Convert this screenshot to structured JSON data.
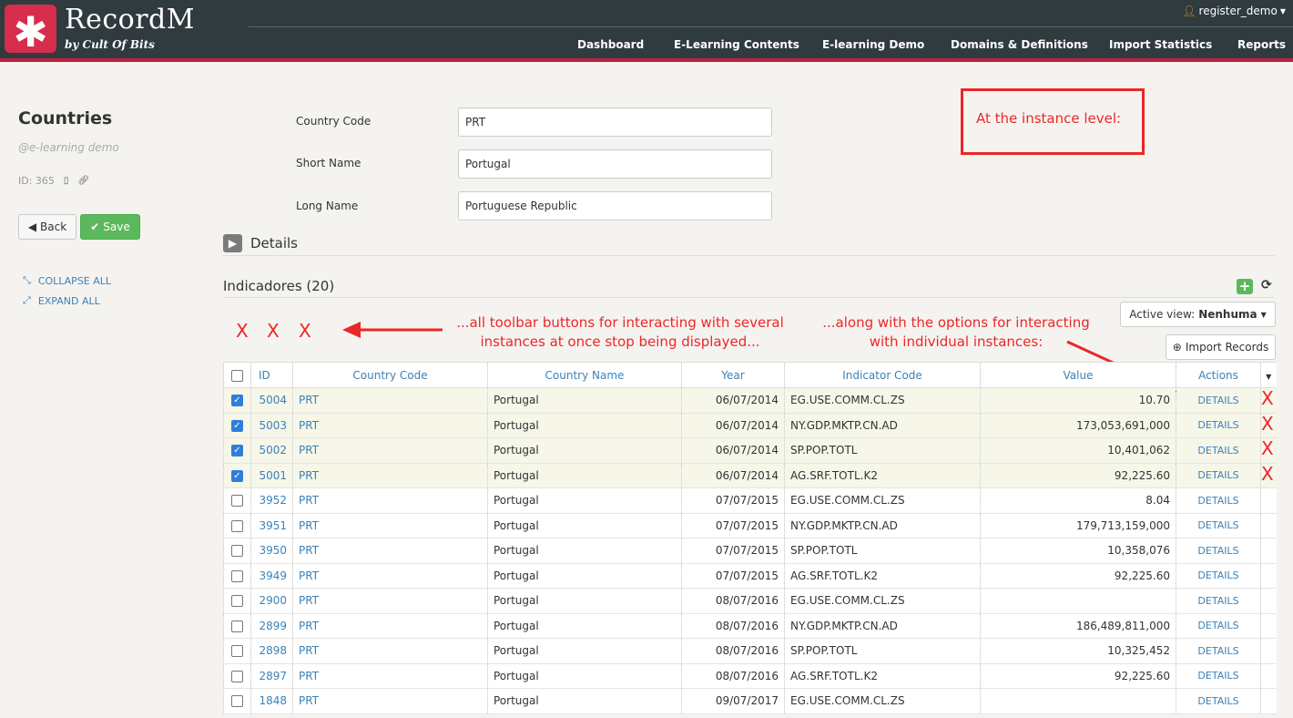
{
  "app": {
    "logo_symbol": "✱",
    "title": "RecordM",
    "subtitle": "by Cult Of Bits",
    "user": "register_demo"
  },
  "nav": {
    "items": [
      {
        "label": "Dashboard"
      },
      {
        "label": "E-Learning Contents"
      },
      {
        "label": "E-learning Demo"
      },
      {
        "label": "Domains & Definitions"
      },
      {
        "label": "Import Statistics"
      },
      {
        "label": "Reports"
      }
    ]
  },
  "sidebar": {
    "title": "Countries",
    "subtitle": "@e-learning demo",
    "id_label": "ID: 365",
    "back_label": "Back",
    "save_label": "Save",
    "collapse_label": "COLLAPSE ALL",
    "expand_label": "EXPAND ALL"
  },
  "form": {
    "fields": [
      {
        "label": "Country Code",
        "value": "PRT"
      },
      {
        "label": "Short Name",
        "value": "Portugal"
      },
      {
        "label": "Long Name",
        "value": "Portuguese Republic"
      }
    ],
    "details_label": "Details"
  },
  "annotations": {
    "box_text": "At the instance level:",
    "toolbar_line1": "...all toolbar buttons for interacting with several",
    "toolbar_line2": "instances at once stop being displayed...",
    "options_line1": "...along with the options for interacting",
    "options_line2": "with individual instances:",
    "x_mark": "X"
  },
  "indicadores": {
    "title": "Indicadores (20)",
    "active_view_label": "Active view:",
    "active_view_value": "Nenhuma",
    "import_label": "Import Records",
    "columns": [
      "ID",
      "Country Code",
      "Country Name",
      "Year",
      "Indicator Code",
      "Value",
      "Actions"
    ],
    "rows": [
      {
        "checked": true,
        "id": "5004",
        "cc": "PRT",
        "cn": "Portugal",
        "year": "06/07/2014",
        "ic": "EG.USE.COMM.CL.ZS",
        "value": "10.70",
        "action": "DETAILS"
      },
      {
        "checked": true,
        "id": "5003",
        "cc": "PRT",
        "cn": "Portugal",
        "year": "06/07/2014",
        "ic": "NY.GDP.MKTP.CN.AD",
        "value": "173,053,691,000",
        "action": "DETAILS"
      },
      {
        "checked": true,
        "id": "5002",
        "cc": "PRT",
        "cn": "Portugal",
        "year": "06/07/2014",
        "ic": "SP.POP.TOTL",
        "value": "10,401,062",
        "action": "DETAILS"
      },
      {
        "checked": true,
        "id": "5001",
        "cc": "PRT",
        "cn": "Portugal",
        "year": "06/07/2014",
        "ic": "AG.SRF.TOTL.K2",
        "value": "92,225.60",
        "action": "DETAILS"
      },
      {
        "checked": false,
        "id": "3952",
        "cc": "PRT",
        "cn": "Portugal",
        "year": "07/07/2015",
        "ic": "EG.USE.COMM.CL.ZS",
        "value": "8.04",
        "action": "DETAILS"
      },
      {
        "checked": false,
        "id": "3951",
        "cc": "PRT",
        "cn": "Portugal",
        "year": "07/07/2015",
        "ic": "NY.GDP.MKTP.CN.AD",
        "value": "179,713,159,000",
        "action": "DETAILS"
      },
      {
        "checked": false,
        "id": "3950",
        "cc": "PRT",
        "cn": "Portugal",
        "year": "07/07/2015",
        "ic": "SP.POP.TOTL",
        "value": "10,358,076",
        "action": "DETAILS"
      },
      {
        "checked": false,
        "id": "3949",
        "cc": "PRT",
        "cn": "Portugal",
        "year": "07/07/2015",
        "ic": "AG.SRF.TOTL.K2",
        "value": "92,225.60",
        "action": "DETAILS"
      },
      {
        "checked": false,
        "id": "2900",
        "cc": "PRT",
        "cn": "Portugal",
        "year": "08/07/2016",
        "ic": "EG.USE.COMM.CL.ZS",
        "value": "",
        "action": "DETAILS"
      },
      {
        "checked": false,
        "id": "2899",
        "cc": "PRT",
        "cn": "Portugal",
        "year": "08/07/2016",
        "ic": "NY.GDP.MKTP.CN.AD",
        "value": "186,489,811,000",
        "action": "DETAILS"
      },
      {
        "checked": false,
        "id": "2898",
        "cc": "PRT",
        "cn": "Portugal",
        "year": "08/07/2016",
        "ic": "SP.POP.TOTL",
        "value": "10,325,452",
        "action": "DETAILS"
      },
      {
        "checked": false,
        "id": "2897",
        "cc": "PRT",
        "cn": "Portugal",
        "year": "08/07/2016",
        "ic": "AG.SRF.TOTL.K2",
        "value": "92,225.60",
        "action": "DETAILS"
      },
      {
        "checked": false,
        "id": "1848",
        "cc": "PRT",
        "cn": "Portugal",
        "year": "09/07/2017",
        "ic": "EG.USE.COMM.CL.ZS",
        "value": "",
        "action": "DETAILS"
      }
    ]
  },
  "colors": {
    "header_bg": "#2f3b3f",
    "brand_red": "#d72d4c",
    "link_blue": "#3b82b8",
    "save_green": "#5cb85c",
    "annotation_red": "#ec2727",
    "selected_row": "#f6f6e9"
  },
  "icons": {
    "user": "user-icon",
    "copy": "copy-icon",
    "link": "link-icon",
    "back": "arrow-left-icon",
    "save": "check-icon",
    "collapse": "collapse-icon",
    "expand": "expand-icon",
    "details_toggle": "chevron-right-icon",
    "add": "plus-icon",
    "refresh": "refresh-icon",
    "import": "upload-icon"
  }
}
